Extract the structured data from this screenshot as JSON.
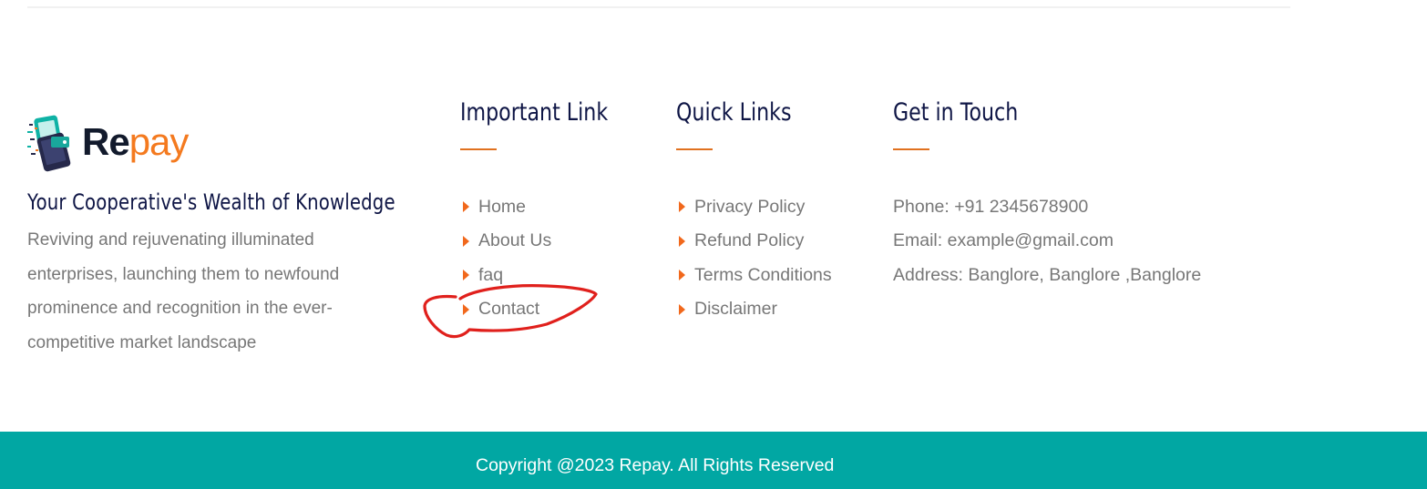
{
  "brand": {
    "logo_re": "Re",
    "logo_pay": "pay",
    "tagline": "Your Cooperative's Wealth of Knowledge",
    "description": "Reviving and rejuvenating illuminated enterprises, launching them to newfound prominence and recognition in the ever-competitive market landscape"
  },
  "important_links": {
    "title": "Important Link",
    "items": [
      "Home",
      "About Us",
      "faq",
      "Contact"
    ]
  },
  "quick_links": {
    "title": "Quick Links",
    "items": [
      "Privacy Policy",
      "Refund Policy",
      "Terms Conditions",
      "Disclaimer"
    ]
  },
  "contact": {
    "title": "Get in Touch",
    "phone": "Phone: +91 2345678900",
    "email": "Email: example@gmail.com",
    "address": "Address: Banglore, Banglore ,Banglore"
  },
  "footer": {
    "copyright": "Copyright @2023 Repay. All Rights Reserved"
  },
  "colors": {
    "accent": "#f1681c",
    "heading": "#0e1545",
    "text": "#777777",
    "footer_bg": "#01a7a3",
    "annotation": "#e0201c"
  }
}
